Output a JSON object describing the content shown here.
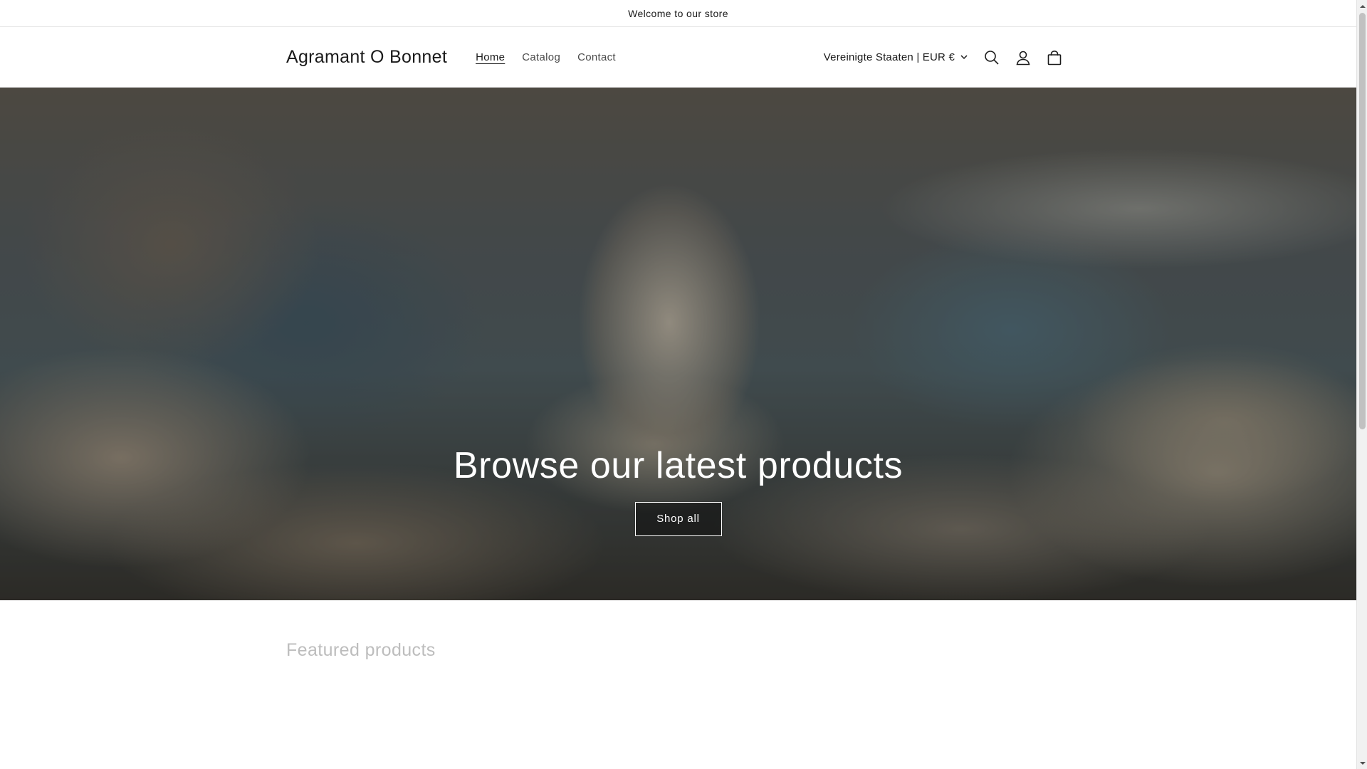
{
  "announcement": {
    "text": "Welcome to our store"
  },
  "header": {
    "brand": "Agramant O Bonnet",
    "nav": [
      {
        "label": "Home",
        "active": true
      },
      {
        "label": "Catalog",
        "active": false
      },
      {
        "label": "Contact",
        "active": false
      }
    ],
    "country_selector": "Vereinigte Staaten | EUR €",
    "icons": [
      "search-icon",
      "account-icon",
      "cart-icon"
    ]
  },
  "hero": {
    "title": "Browse our latest products",
    "button_label": "Shop all"
  },
  "featured": {
    "title": "Featured products"
  },
  "colors": {
    "text": "#121212",
    "muted_heading": "#bdbdbd",
    "border": "#e6e6e6",
    "hero_text": "#ffffff"
  }
}
